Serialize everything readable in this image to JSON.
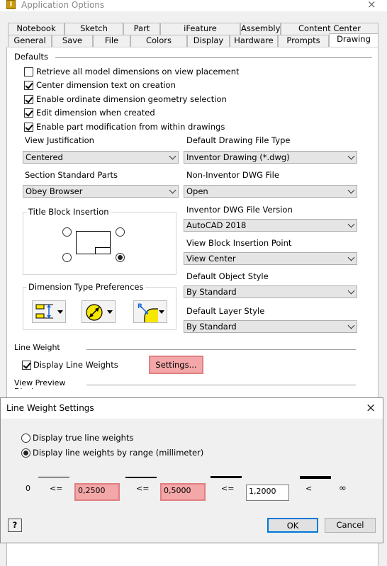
{
  "window": {
    "title": "Application Options",
    "app_icon": "I",
    "close_glyph": "×",
    "tabs_row1": [
      "Notebook",
      "Sketch",
      "Part",
      "iFeature",
      "Assembly",
      "Content Center"
    ],
    "tabs_row2": [
      "General",
      "Save",
      "File",
      "Colors",
      "Display",
      "Hardware",
      "Prompts",
      "Drawing"
    ],
    "active_tab": "Drawing"
  },
  "defaults": {
    "header": "Defaults",
    "checkboxes": [
      {
        "label": "Retrieve all model dimensions on view placement",
        "checked": false
      },
      {
        "label": "Center dimension text on creation",
        "checked": true
      },
      {
        "label": "Enable ordinate dimension geometry selection",
        "checked": true
      },
      {
        "label": "Edit dimension when created",
        "checked": true
      },
      {
        "label": "Enable part modification from within drawings",
        "checked": true
      }
    ]
  },
  "left": {
    "view_justification": {
      "label": "View Justification",
      "value": "Centered"
    },
    "section_standard_parts": {
      "label": "Section Standard Parts",
      "value": "Obey Browser"
    },
    "title_block_insertion": {
      "label": "Title Block Insertion",
      "selected": "bottom-right"
    },
    "dimension_type_preferences": {
      "label": "Dimension Type Preferences",
      "icons": [
        "linear-dimension-icon",
        "diameter-dimension-icon",
        "radius-dimension-icon"
      ]
    }
  },
  "right": {
    "default_drawing_file_type": {
      "label": "Default Drawing File Type",
      "value": "Inventor Drawing (*.dwg)"
    },
    "non_inventor_dwg_file": {
      "label": "Non-Inventor DWG File",
      "value": "Open"
    },
    "inventor_dwg_file_version": {
      "label": "Inventor DWG File Version",
      "value": "AutoCAD 2018"
    },
    "view_block_insertion_point": {
      "label": "View Block Insertion Point",
      "value": "View Center"
    },
    "default_object_style": {
      "label": "Default Object Style",
      "value": "By Standard"
    },
    "default_layer_style": {
      "label": "Default Layer Style",
      "value": "By Standard"
    }
  },
  "line_weight_display": {
    "header": "Line Weight Display",
    "checkbox_label": "Display Line Weights",
    "checked": true,
    "settings_button": "Settings..."
  },
  "view_preview_display": {
    "header": "View Preview Display"
  },
  "lw_dialog": {
    "title": "Line Weight Settings",
    "close_glyph": "×",
    "option_true": "Display true line weights",
    "option_range": "Display line weights by range (millimeter)",
    "selected": "range",
    "zero_label": "0",
    "le_symbol": "<=",
    "lt_symbol": "<",
    "infinity_symbol": "∞",
    "values": [
      "0,2500",
      "0,5000",
      "1,2000"
    ],
    "help_glyph": "?",
    "ok_label": "OK",
    "cancel_label": "Cancel"
  }
}
